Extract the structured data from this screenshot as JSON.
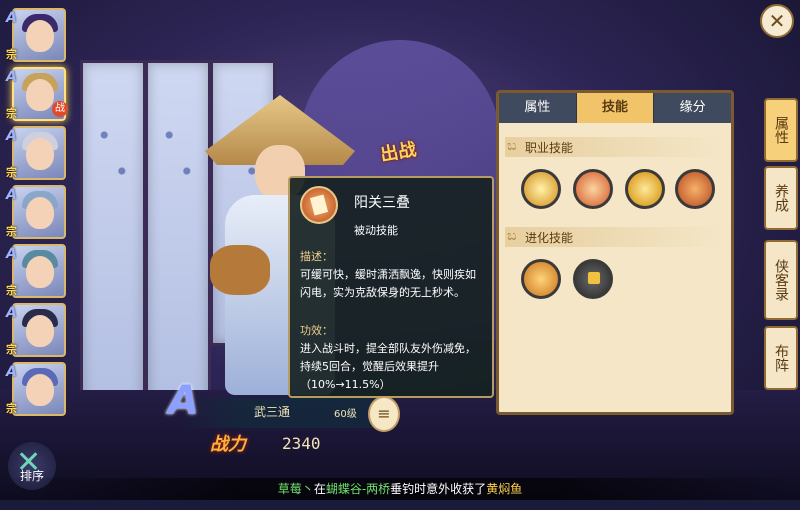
{
  "hero_list": [
    {
      "tier": "A",
      "tag": "宗",
      "hair": "#3a2a6a",
      "selected": false,
      "battle": false
    },
    {
      "tier": "A",
      "tag": "宗",
      "hair": "#c7a25a",
      "selected": true,
      "battle": true
    },
    {
      "tier": "A",
      "tag": "宗",
      "hair": "#cfcfe0",
      "selected": false,
      "battle": false
    },
    {
      "tier": "A",
      "tag": "宗",
      "hair": "#8aa6c8",
      "selected": false,
      "battle": false
    },
    {
      "tier": "A",
      "tag": "宗",
      "hair": "#5a8aa0",
      "selected": false,
      "battle": false
    },
    {
      "tier": "A",
      "tag": "宗",
      "hair": "#2a2a4a",
      "selected": false,
      "battle": false
    },
    {
      "tier": "A",
      "tag": "宗",
      "hair": "#5a6ab8",
      "selected": false,
      "battle": false
    }
  ],
  "battle_badge": "战",
  "sort_button": "排序",
  "chuzhan": "出战",
  "tooltip": {
    "skill_name": "阳关三叠",
    "skill_type": "被动技能",
    "desc_title": "描述：",
    "desc_text": "可缓可快，缓时潇洒飘逸，快则疾如闪电，实为克敌保身的无上秒术。",
    "effect_title": "功效：",
    "effect_text": "进入战斗时，提全部队友外伤减免，持续5回合，觉醒后效果提升（10%→11.5%）"
  },
  "hero": {
    "grade": "A",
    "name": "武三通",
    "level": "60级",
    "power_label": "战力",
    "power": "2340"
  },
  "panel": {
    "tabs": [
      "属性",
      "技能",
      "缘分"
    ],
    "active_tab": 1,
    "section_job": "职业技能",
    "section_evolve": "进化技能"
  },
  "side_tabs": [
    "属性",
    "养成",
    "侠客录",
    "布阵"
  ],
  "active_side_tab": 0,
  "close_icon": "✕",
  "ticker": {
    "player": "草莓丶",
    "p1": "在",
    "location": "蝴蝶谷-两桥",
    "p2": "垂钓时意外收获了",
    "item": "黄焖鱼"
  }
}
